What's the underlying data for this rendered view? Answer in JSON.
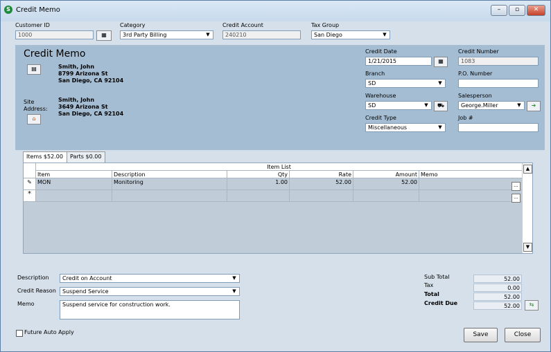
{
  "window": {
    "title": "Credit Memo",
    "icon": "S",
    "min": "–",
    "max": "▫",
    "close": "✕"
  },
  "header": {
    "customer_id_label": "Customer ID",
    "customer_id": "1000",
    "category_label": "Category",
    "category": "3rd Party Billing",
    "credit_account_label": "Credit Account",
    "credit_account": "240210",
    "tax_group_label": "Tax Group",
    "tax_group": "San Diego"
  },
  "panel": {
    "heading": "Credit Memo",
    "bill_name": "Smith, John",
    "bill_street": "8799 Arizona St",
    "bill_city": "San Diego, CA  92104",
    "site_label_1": "Site",
    "site_label_2": "Address:",
    "site_name": "Smith, John",
    "site_street": "3649 Arizona St",
    "site_city": "San Diego, CA  92104",
    "credit_date_label": "Credit Date",
    "credit_date": "1/21/2015",
    "credit_number_label": "Credit Number",
    "credit_number": "1083",
    "branch_label": "Branch",
    "branch": "SD",
    "po_label": "P.O. Number",
    "po": "",
    "warehouse_label": "Warehouse",
    "warehouse": "SD",
    "salesperson_label": "Salesperson",
    "salesperson": "George.Miller",
    "credit_type_label": "Credit Type",
    "credit_type": "Miscellaneous",
    "job_label": "Job #",
    "job": ""
  },
  "tabs": [
    {
      "label": "Items  $52.00"
    },
    {
      "label": "Parts  $0.00"
    }
  ],
  "grid": {
    "title": "Item List",
    "columns": [
      "Item",
      "Description",
      "Qty",
      "Rate",
      "Amount",
      "Memo"
    ],
    "rows": [
      {
        "marker": "✎",
        "item": "MON",
        "description": "Monitoring",
        "qty": "1.00",
        "rate": "52.00",
        "amount": "52.00",
        "memo": ""
      },
      {
        "marker": "*",
        "item": "",
        "description": "",
        "qty": "",
        "rate": "",
        "amount": "",
        "memo": ""
      }
    ]
  },
  "footer": {
    "description_label": "Description",
    "description": "Credit on Account",
    "reason_label": "Credit Reason",
    "reason": "Suspend Service",
    "memo_label": "Memo",
    "memo": "Suspend service for construction work.",
    "subtotal_label": "Sub Total",
    "subtotal": "52.00",
    "tax_label": "Tax",
    "tax": "0.00",
    "total_label": "Total",
    "total": "52.00",
    "credit_due_label": "Credit Due",
    "credit_due": "52.00",
    "future_label": "Future Auto Apply",
    "save": "Save",
    "close": "Close"
  }
}
